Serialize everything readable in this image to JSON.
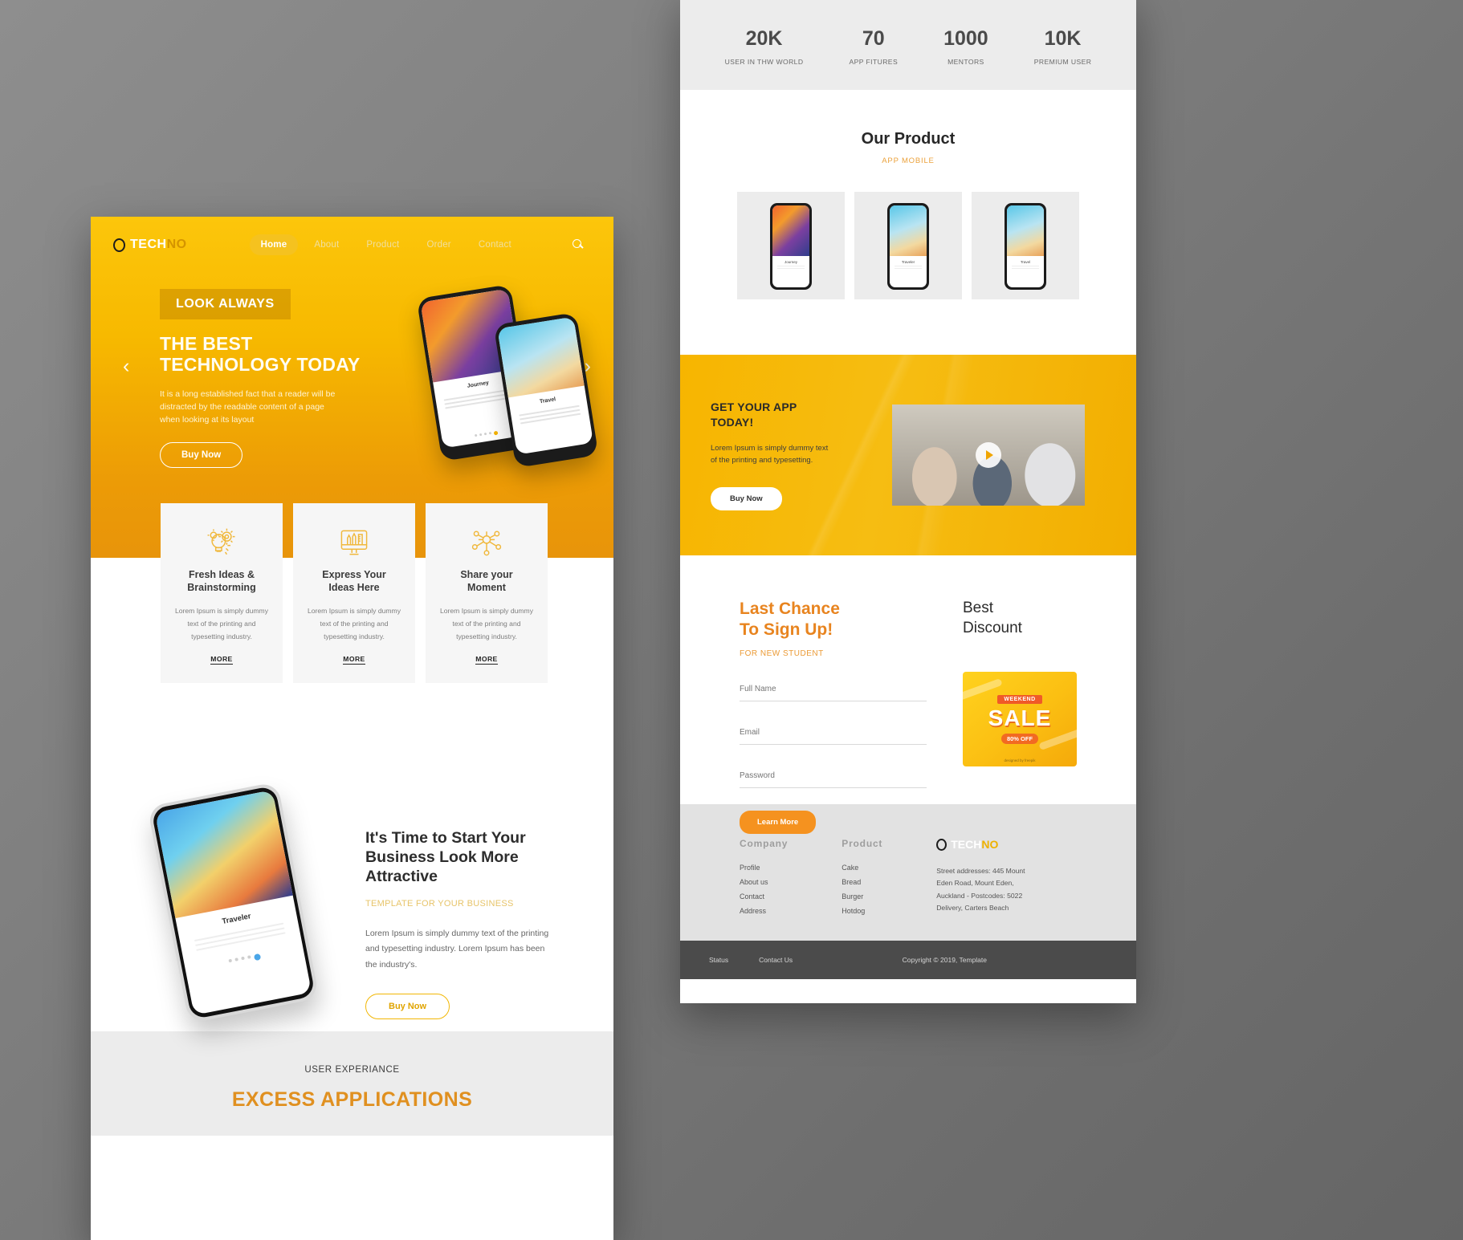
{
  "left": {
    "nav": {
      "logo_ring": "logo-ring",
      "logo_white": "TECH",
      "logo_yellow": "NO",
      "links": [
        {
          "label": "Home",
          "active": true
        },
        {
          "label": "About",
          "active": false
        },
        {
          "label": "Product",
          "active": false
        },
        {
          "label": "Order",
          "active": false
        },
        {
          "label": "Contact",
          "active": false
        }
      ],
      "search_icon": "search-icon"
    },
    "hero": {
      "badge": "LOOK ALWAYS",
      "title_line1": "THE BEST",
      "title_line2": "TECHNOLOGY TODAY",
      "paragraph": "It is a long established fact that a reader will be distracted by the readable content of a page when looking at its layout",
      "cta": "Buy Now",
      "prev_arrow": "‹",
      "next_arrow": "›",
      "phone1_label": "Journey",
      "phone2_label": "Travel"
    },
    "cards": [
      {
        "icon": "lightbulb-gear-icon",
        "title": "Fresh Ideas &\nBrainstorming",
        "title_l1": "Fresh Ideas &",
        "title_l2": "Brainstorming",
        "body": "Lorem Ipsum is simply dummy text of the printing and typesetting industry.",
        "more": "MORE"
      },
      {
        "icon": "monitor-pencil-icon",
        "title_l1": "Express Your",
        "title_l2": "Ideas Here",
        "body": "Lorem Ipsum is simply dummy text of the printing and typesetting industry.",
        "more": "MORE"
      },
      {
        "icon": "share-network-icon",
        "title_l1": "Share your",
        "title_l2": "Moment",
        "body": "Lorem Ipsum is simply dummy text of the printing and typesetting industry.",
        "more": "MORE"
      }
    ],
    "business": {
      "heading": "It's Time to Start Your Business Look More Attractive",
      "subtitle": "TEMPLATE FOR YOUR BUSINESS",
      "paragraph": "Lorem Ipsum is simply dummy text of the printing and typesetting industry. Lorem Ipsum has been the industry's.",
      "cta": "Buy Now",
      "phone_label": "Traveler"
    },
    "excess": {
      "kicker": "USER EXPERIANCE",
      "title": "EXCESS APPLICATIONS"
    }
  },
  "right": {
    "stats": [
      {
        "number": "20K",
        "label": "USER IN THW WORLD"
      },
      {
        "number": "70",
        "label": "APP FITURES"
      },
      {
        "number": "1000",
        "label": "MENTORS"
      },
      {
        "number": "10K",
        "label": "PREMIUM USER"
      }
    ],
    "product": {
      "title": "Our Product",
      "subtitle": "APP MOBILE",
      "items": [
        {
          "label": "Journey"
        },
        {
          "label": "Traveler"
        },
        {
          "label": "Travel"
        }
      ]
    },
    "getapp": {
      "title_l1": "GET YOUR APP",
      "title_l2": "TODAY!",
      "paragraph": "Lorem Ipsum is simply dummy text of the printing and typesetting.",
      "cta": "Buy Now",
      "play_icon": "play-icon"
    },
    "signup": {
      "title_l1": "Last Chance",
      "title_l2": "To Sign Up!",
      "kicker": "FOR NEW STUDENT",
      "fields": [
        {
          "placeholder": "Full Name",
          "value": ""
        },
        {
          "placeholder": "Email",
          "value": ""
        },
        {
          "placeholder": "Password",
          "value": ""
        }
      ],
      "cta": "Learn More",
      "discount_title_l1": "Best",
      "discount_title_l2": "Discount",
      "sale": {
        "weekend": "WEEKEND",
        "sale": "SALE",
        "off": "80% OFF",
        "credit": "designed by freepik"
      }
    },
    "footer": {
      "columns": [
        {
          "heading": "Company",
          "items": [
            "Profile",
            "About us",
            "Contact",
            "Address"
          ]
        },
        {
          "heading": "Product",
          "items": [
            "Cake",
            "Bread",
            "Burger",
            "Hotdog"
          ]
        }
      ],
      "logo_white": "TECH",
      "logo_yellow": "NO",
      "address": "Street addresses: 445 Mount Eden Road, Mount Eden, Auckland - Postcodes: 5022 Delivery, Carters Beach",
      "address_lines": [
        "Street addresses: 445 Mount",
        "Eden Road, Mount Eden,",
        "Auckland - Postcodes: 5022",
        "Delivery, Carters Beach"
      ]
    },
    "bottombar": {
      "status": "Status",
      "contact": "Contact Us",
      "copyright": "Copyright © 2019, Template"
    }
  },
  "colors": {
    "brand_yellow": "#f7b900",
    "brand_orange": "#e8841f",
    "accent_gold": "#eeb100",
    "dark": "#2d2d2d"
  }
}
